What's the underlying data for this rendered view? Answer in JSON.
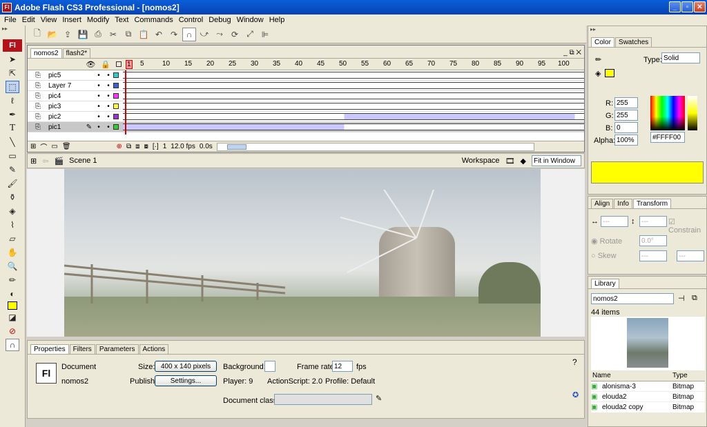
{
  "window": {
    "title": "Adobe Flash CS3 Professional - [nomos2]",
    "app_badge": "Fl"
  },
  "menu": [
    "File",
    "Edit",
    "View",
    "Insert",
    "Modify",
    "Text",
    "Commands",
    "Control",
    "Debug",
    "Window",
    "Help"
  ],
  "doc_tabs": [
    "nomos2",
    "flash2*"
  ],
  "timeline": {
    "frame_numbers": [
      "1",
      "5",
      "10",
      "15",
      "20",
      "25",
      "30",
      "35",
      "40",
      "45",
      "50",
      "55",
      "60",
      "65",
      "70",
      "75",
      "80",
      "85",
      "90",
      "95",
      "100"
    ],
    "layers": [
      {
        "name": "pic5",
        "color": "#33cccc"
      },
      {
        "name": "Layer 7",
        "color": "#3366cc"
      },
      {
        "name": "pic4",
        "color": "#ff33ff"
      },
      {
        "name": "pic3",
        "color": "#ffff33"
      },
      {
        "name": "pic2",
        "color": "#9933cc"
      },
      {
        "name": "pic1",
        "color": "#33cc33"
      }
    ],
    "current_frame": "1",
    "fps": "12.0 fps",
    "time": "0.0s"
  },
  "edit_bar": {
    "scene": "Scene 1",
    "workspace": "Workspace",
    "zoom": "Fit in Window"
  },
  "properties": {
    "tabs": [
      "Properties",
      "Filters",
      "Parameters",
      "Actions"
    ],
    "doc_label": "Document",
    "doc_name": "nomos2",
    "size_label": "Size:",
    "size_value": "400 x 140 pixels",
    "background_label": "Background:",
    "frame_rate_label": "Frame rate:",
    "frame_rate": "12",
    "fps_unit": "fps",
    "publish_label": "Publish:",
    "settings_button": "Settings...",
    "player": "Player:  9",
    "actionscript": "ActionScript:  2.0",
    "profile": "Profile:  Default",
    "doc_class_label": "Document class:",
    "logo": "Fl"
  },
  "color_panel": {
    "tabs": [
      "Color",
      "Swatches"
    ],
    "type_label": "Type:",
    "type_value": "Solid",
    "r_label": "R:",
    "r": "255",
    "g_label": "G:",
    "g": "255",
    "b_label": "B:",
    "b": "0",
    "alpha_label": "Alpha:",
    "alpha": "100%",
    "hex": "#FFFF00",
    "swatch_color": "#ffff00"
  },
  "transform_panel": {
    "tabs": [
      "Align",
      "Info",
      "Transform"
    ],
    "constrain": "Constrain",
    "rotate": "Rotate",
    "skew": "Skew",
    "rotate_value": "0.0°",
    "blank": "---"
  },
  "library": {
    "tab": "Library",
    "doc": "nomos2",
    "count": "44 items",
    "columns": [
      "Name",
      "Type"
    ],
    "items": [
      {
        "name": "alonisma-3",
        "type": "Bitmap"
      },
      {
        "name": "elouda2",
        "type": "Bitmap"
      },
      {
        "name": "elouda2 copy",
        "type": "Bitmap"
      }
    ]
  }
}
